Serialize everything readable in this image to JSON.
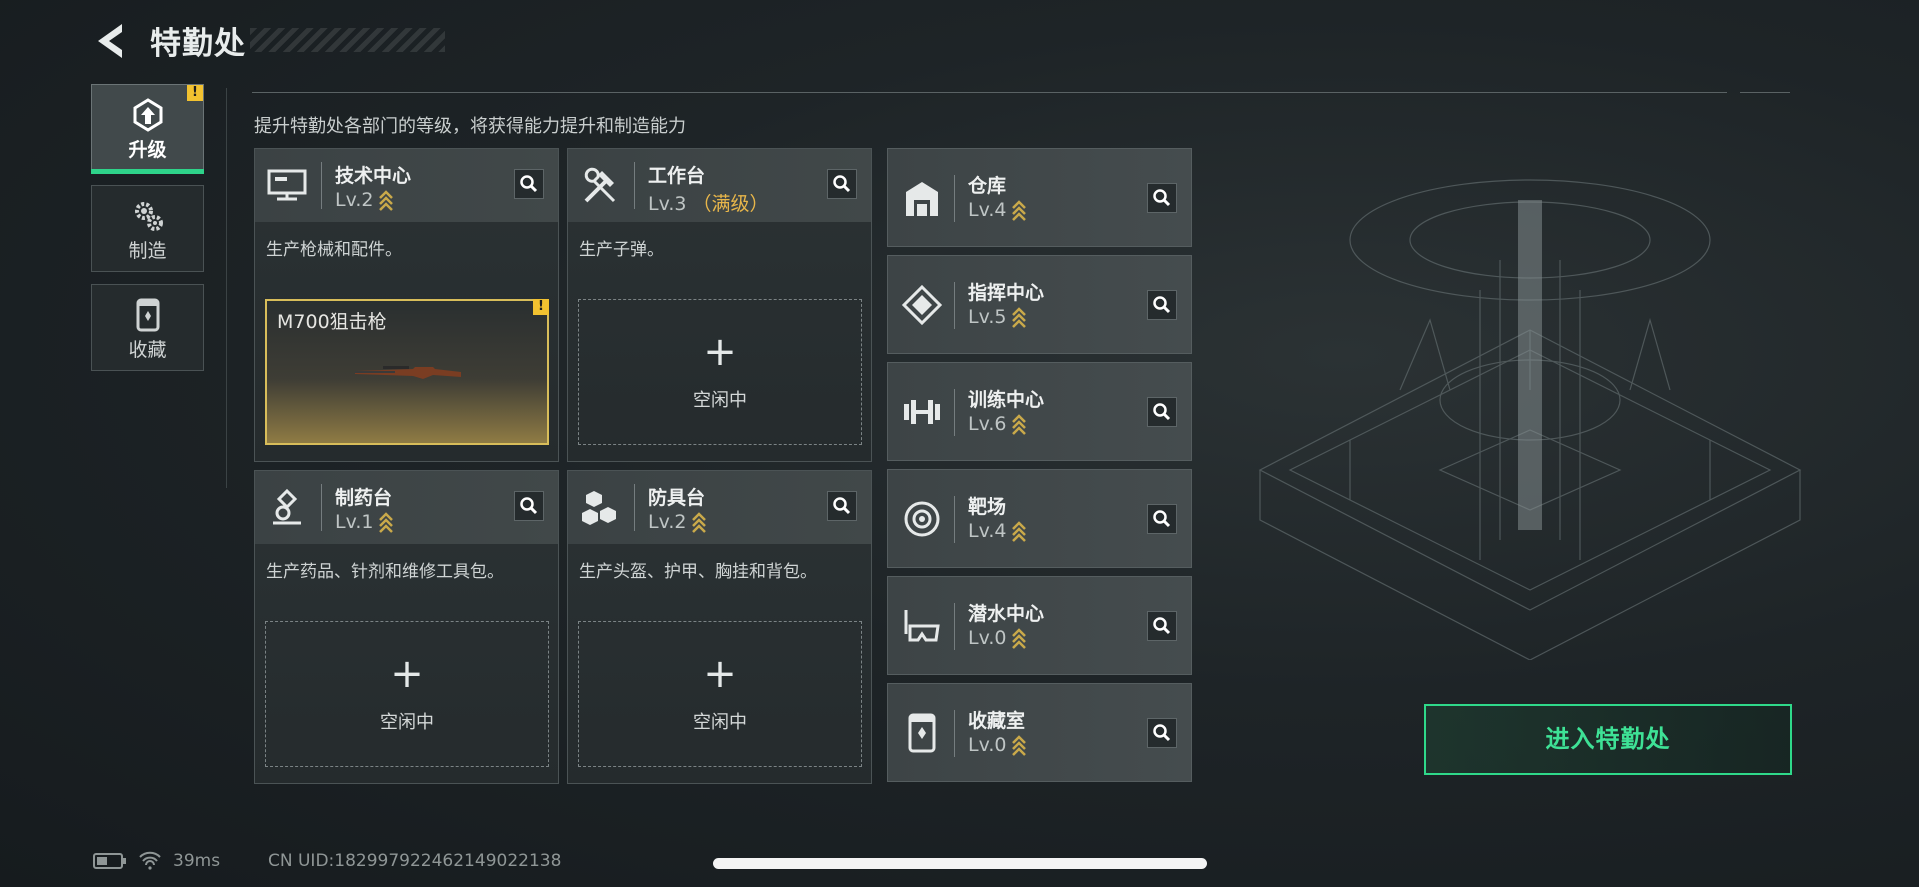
{
  "header": {
    "title": "特勤处"
  },
  "subtitle": "提升特勤处各部门的等级，将获得能力提升和制造能力",
  "nav": [
    {
      "label": "升级",
      "icon": "upgrade-icon",
      "active": true,
      "warning": "!"
    },
    {
      "label": "制造",
      "icon": "gears-icon",
      "active": false
    },
    {
      "label": "收藏",
      "icon": "collection-icon",
      "active": false
    }
  ],
  "cards": [
    {
      "name": "技术中心",
      "level": "Lv.2",
      "max": "",
      "icon": "computer-icon",
      "desc": "生产枪械和配件。",
      "slot": {
        "item": "M700狙击枪",
        "idle": "",
        "warning": "!"
      }
    },
    {
      "name": "工作台",
      "level": "Lv.3",
      "max": "（满级）",
      "icon": "tools-icon",
      "desc": "生产子弹。",
      "slot": {
        "plus": "+",
        "idle": "空闲中"
      }
    },
    {
      "name": "制药台",
      "level": "Lv.1",
      "max": "",
      "icon": "microscope-icon",
      "desc": "生产药品、针剂和维修工具包。",
      "slot": {
        "plus": "+",
        "idle": "空闲中"
      }
    },
    {
      "name": "防具台",
      "level": "Lv.2",
      "max": "",
      "icon": "armor-boxes-icon",
      "desc": "生产头盔、护甲、胸挂和背包。",
      "slot": {
        "plus": "+",
        "idle": "空闲中"
      }
    }
  ],
  "facilities": [
    {
      "name": "仓库",
      "level": "Lv.4",
      "icon": "warehouse-icon"
    },
    {
      "name": "指挥中心",
      "level": "Lv.5",
      "icon": "command-icon"
    },
    {
      "name": "训练中心",
      "level": "Lv.6",
      "icon": "dumbbell-icon"
    },
    {
      "name": "靶场",
      "level": "Lv.4",
      "icon": "target-icon"
    },
    {
      "name": "潜水中心",
      "level": "Lv.0",
      "icon": "diving-mask-icon"
    },
    {
      "name": "收藏室",
      "level": "Lv.0",
      "icon": "collection-room-icon"
    }
  ],
  "enter_button": "进入特勤处",
  "status": {
    "ping": "39ms",
    "uid": "CN UID:18299792246214902213​8"
  },
  "colors": {
    "accent": "#2fd98a",
    "gold": "#e8b64a",
    "warning": "#f2c230"
  }
}
